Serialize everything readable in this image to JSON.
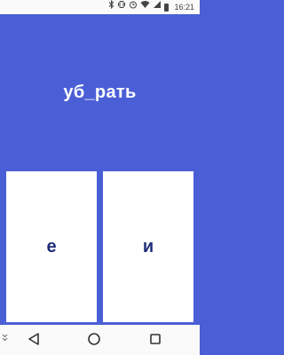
{
  "status_bar": {
    "time": "16:21",
    "icons": [
      "bluetooth-icon",
      "vibrate-icon",
      "alarm-icon",
      "wifi-icon",
      "cellular-icon",
      "battery-icon"
    ]
  },
  "quiz": {
    "word": "уб_рать",
    "options": [
      {
        "letter": "е"
      },
      {
        "letter": "и"
      }
    ]
  },
  "nav_bar": {
    "icons": [
      "collapse-chevron-icon",
      "back-icon",
      "home-icon",
      "recents-icon"
    ]
  },
  "colors": {
    "background": "#4a5fd6",
    "card": "#ffffff",
    "card_text": "#1f2e7a",
    "status_bar": "#fafafa"
  }
}
